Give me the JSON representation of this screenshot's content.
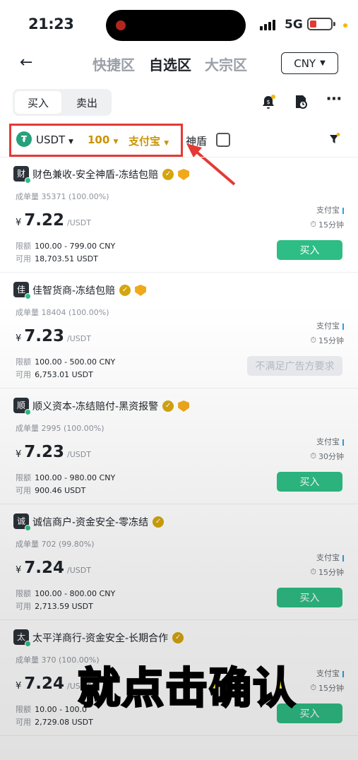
{
  "status_bar": {
    "time": "21:23",
    "network": "5G"
  },
  "nav": {
    "tabs": [
      "快捷区",
      "自选区",
      "大宗区"
    ],
    "active_tab": "自选区",
    "currency": "CNY"
  },
  "trade_toggle": {
    "buy": "买入",
    "sell": "卖出"
  },
  "filter": {
    "asset": "USDT",
    "amount": "100",
    "payment": "支付宝",
    "shield_label": "神盾"
  },
  "colors": {
    "accent_gold": "#c99400",
    "buy_green": "#2ebd85",
    "highlight_red": "#e53935"
  },
  "listing_labels": {
    "volume": "成单量",
    "limit": "限额",
    "available": "可用",
    "currency_symbol": "¥",
    "price_unit": "/USDT"
  },
  "listings": [
    {
      "merchant": "财色兼收-安全神盾-冻结包赔",
      "avatar": "财",
      "verified": true,
      "shield": true,
      "volume": "35371 (100.00%)",
      "price": "7.22",
      "limit": "100.00 - 799.00 CNY",
      "available": "18,703.51 USDT",
      "payment": "支付宝",
      "eta": "15分钟",
      "button": "买入",
      "enabled": true
    },
    {
      "merchant": "佳智货商-冻结包赔",
      "avatar": "佳",
      "verified": true,
      "shield": true,
      "volume": "18404 (100.00%)",
      "price": "7.23",
      "limit": "100.00 - 500.00 CNY",
      "available": "6,753.01 USDT",
      "payment": "支付宝",
      "eta": "15分钟",
      "button": "不满足广告方要求",
      "enabled": false
    },
    {
      "merchant": "顺义资本-冻结赔付-黑资报警",
      "avatar": "顺",
      "verified": true,
      "shield": true,
      "volume": "2995 (100.00%)",
      "price": "7.23",
      "limit": "100.00 - 980.00 CNY",
      "available": "900.46 USDT",
      "payment": "支付宝",
      "eta": "30分钟",
      "button": "买入",
      "enabled": true
    },
    {
      "merchant": "诚信商户-资金安全-零冻结",
      "avatar": "诚",
      "verified": true,
      "shield": false,
      "volume": "702 (99.80%)",
      "price": "7.24",
      "limit": "100.00 - 800.00 CNY",
      "available": "2,713.59 USDT",
      "payment": "支付宝",
      "eta": "15分钟",
      "button": "买入",
      "enabled": true
    },
    {
      "merchant": "太平洋商行-资金安全-长期合作",
      "avatar": "太",
      "verified": true,
      "shield": false,
      "volume": "370 (100.00%)",
      "price": "7.24",
      "limit": "10.00 - 100.00 CNY",
      "limit_visible": "10.00 - 100.0",
      "available": "2,729.08 USDT",
      "payment": "支付宝",
      "eta": "15分钟",
      "button": "买入",
      "enabled": true
    }
  ],
  "caption": "就点击确认"
}
